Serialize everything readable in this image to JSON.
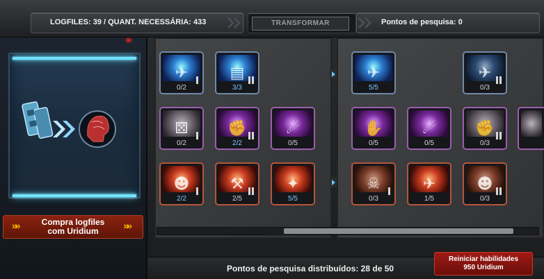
{
  "header": {
    "logfiles_status": "LOGFILES: 39 / QUANT. NECESSÁRIA: 433",
    "transform_label": "TRANSFORMAR",
    "research_points": "Pontos de pesquisa: 0"
  },
  "left_panel": {
    "buy_button_label_line1": "Compra logfiles",
    "buy_button_label_line2": "com Uridium",
    "arrows": "»»"
  },
  "skill_tree_left": [
    {
      "name": "jet-icon",
      "count": "0/2",
      "tier": "I",
      "color": "blue"
    },
    {
      "name": "plates-icon",
      "count": "3/3",
      "tier": "II",
      "color": "blue"
    },
    {
      "name": "dice-icon",
      "count": "0/2",
      "tier": "I",
      "color": "purple-dim"
    },
    {
      "name": "fist-icon",
      "count": "2/2",
      "tier": "II",
      "color": "purple"
    },
    {
      "name": "meteor-icon",
      "count": "0/5",
      "tier": "",
      "color": "purple"
    },
    {
      "name": "head-icon",
      "count": "2/2",
      "tier": "I",
      "color": "red"
    },
    {
      "name": "cannon-icon",
      "count": "2/5",
      "tier": "II",
      "color": "red"
    },
    {
      "name": "rocket-icon",
      "count": "5/5",
      "tier": "",
      "color": "red"
    }
  ],
  "skill_tree_right": [
    {
      "name": "cannon-ship-icon",
      "count": "5/5",
      "tier": "",
      "color": "blue"
    },
    {
      "name": "fighter-icon",
      "count": "0/3",
      "tier": "II",
      "color": "blue"
    },
    {
      "name": "hand-icon",
      "count": "0/5",
      "tier": "",
      "color": "purple"
    },
    {
      "name": "meteor-icon",
      "count": "0/5",
      "tier": "",
      "color": "purple"
    },
    {
      "name": "fist-icon",
      "count": "0/3",
      "tier": "II",
      "color": "purple-dim"
    },
    {
      "name": "skull-icon",
      "count": "0/3",
      "tier": "I",
      "color": "red-dim"
    },
    {
      "name": "ship-fire-icon",
      "count": "1/5",
      "tier": "",
      "color": "red"
    },
    {
      "name": "head-icon",
      "count": "0/3",
      "tier": "II",
      "color": "red-dim"
    }
  ],
  "footer": {
    "distributed_points": "Pontos de pesquisa distribuídos: 28 de 50",
    "reset_line1": "Reiniciar habilidades",
    "reset_line2": "950 Uridium"
  },
  "colors": {
    "accent_cyan": "#6fe4ff",
    "button_red": "#a01a14",
    "highlight_orange": "#ffb800"
  }
}
